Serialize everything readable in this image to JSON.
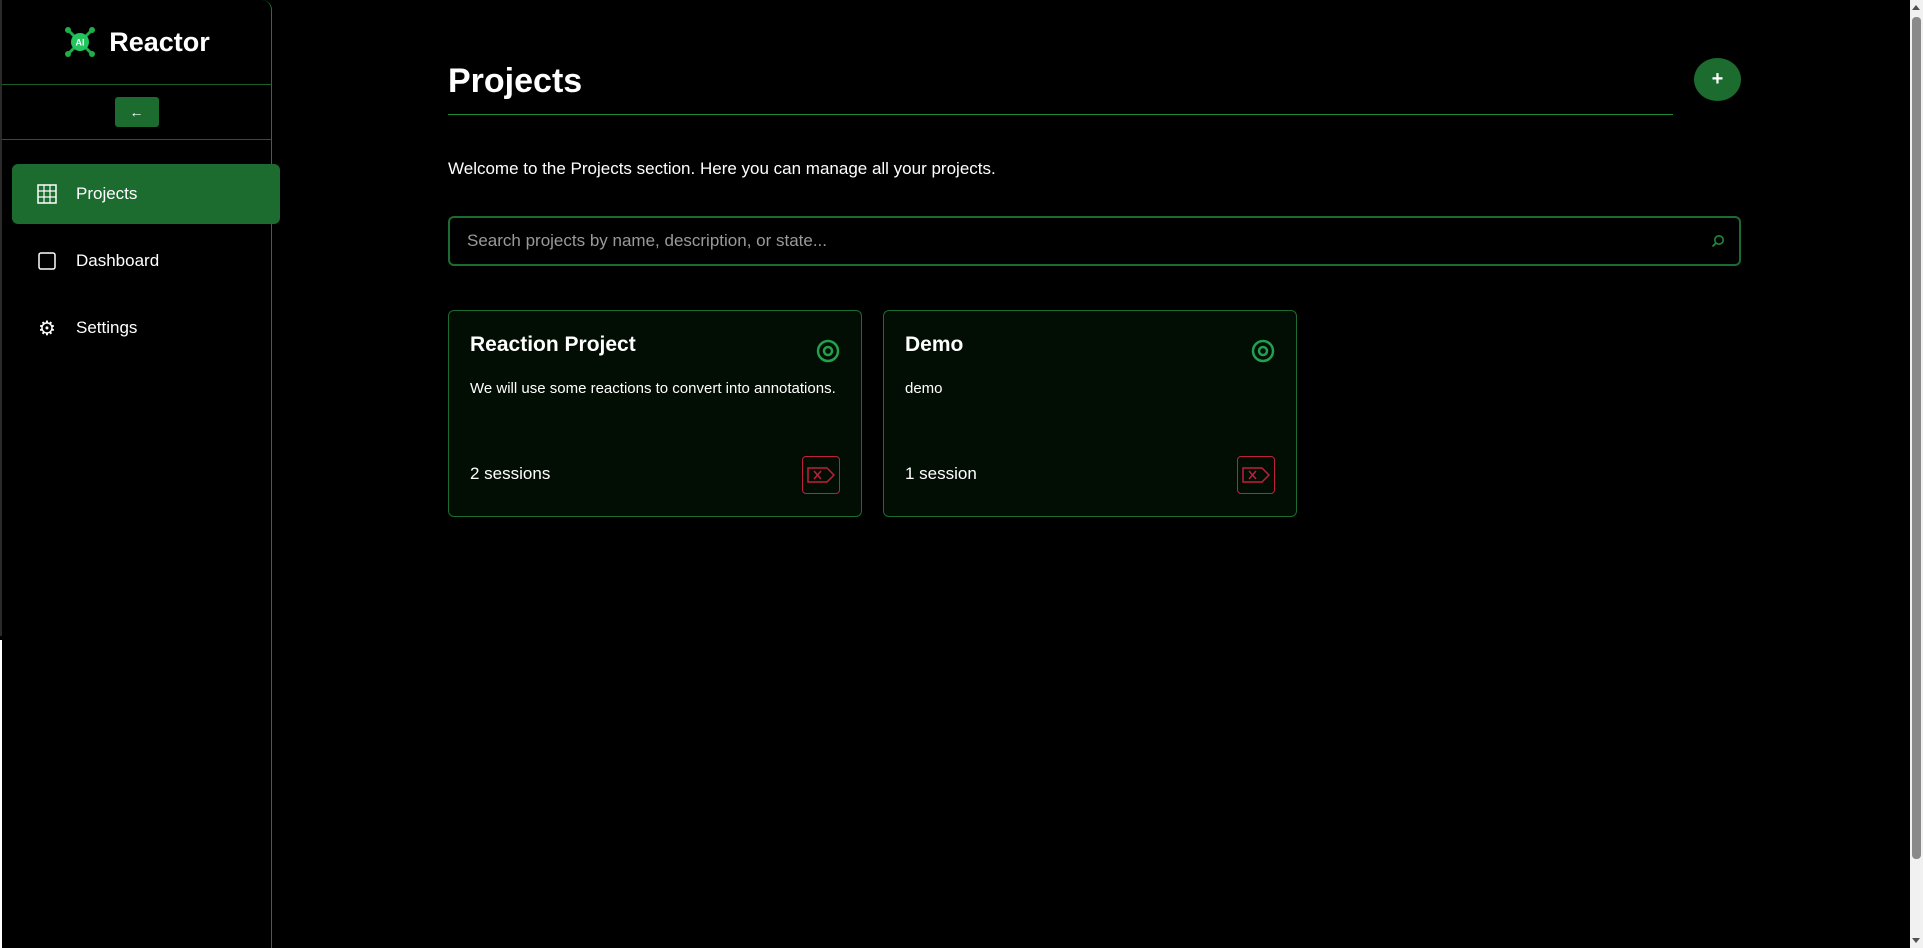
{
  "app": {
    "title": "Reactor",
    "logo_text": "AI",
    "accent_color": "#1c6b2f",
    "danger_color": "#c0203c"
  },
  "sidebar": {
    "collapse_label": "←",
    "items": [
      {
        "label": "Projects",
        "icon": "grid-icon",
        "active": true
      },
      {
        "label": "Dashboard",
        "icon": "square-icon",
        "active": false
      },
      {
        "label": "Settings",
        "icon": "gear-icon",
        "active": false
      }
    ]
  },
  "main": {
    "title": "Projects",
    "add_label": "+",
    "intro": "Welcome to the Projects section. Here you can manage all your projects.",
    "search": {
      "placeholder": "Search projects by name, description, or state...",
      "icon": "search-icon"
    },
    "projects": [
      {
        "name": "Reaction Project",
        "description": "We will use some reactions to convert into annotations.",
        "sessions": "2 sessions",
        "state_icon": "target-icon"
      },
      {
        "name": "Demo",
        "description": "demo",
        "sessions": "1 session",
        "state_icon": "target-icon"
      }
    ]
  }
}
